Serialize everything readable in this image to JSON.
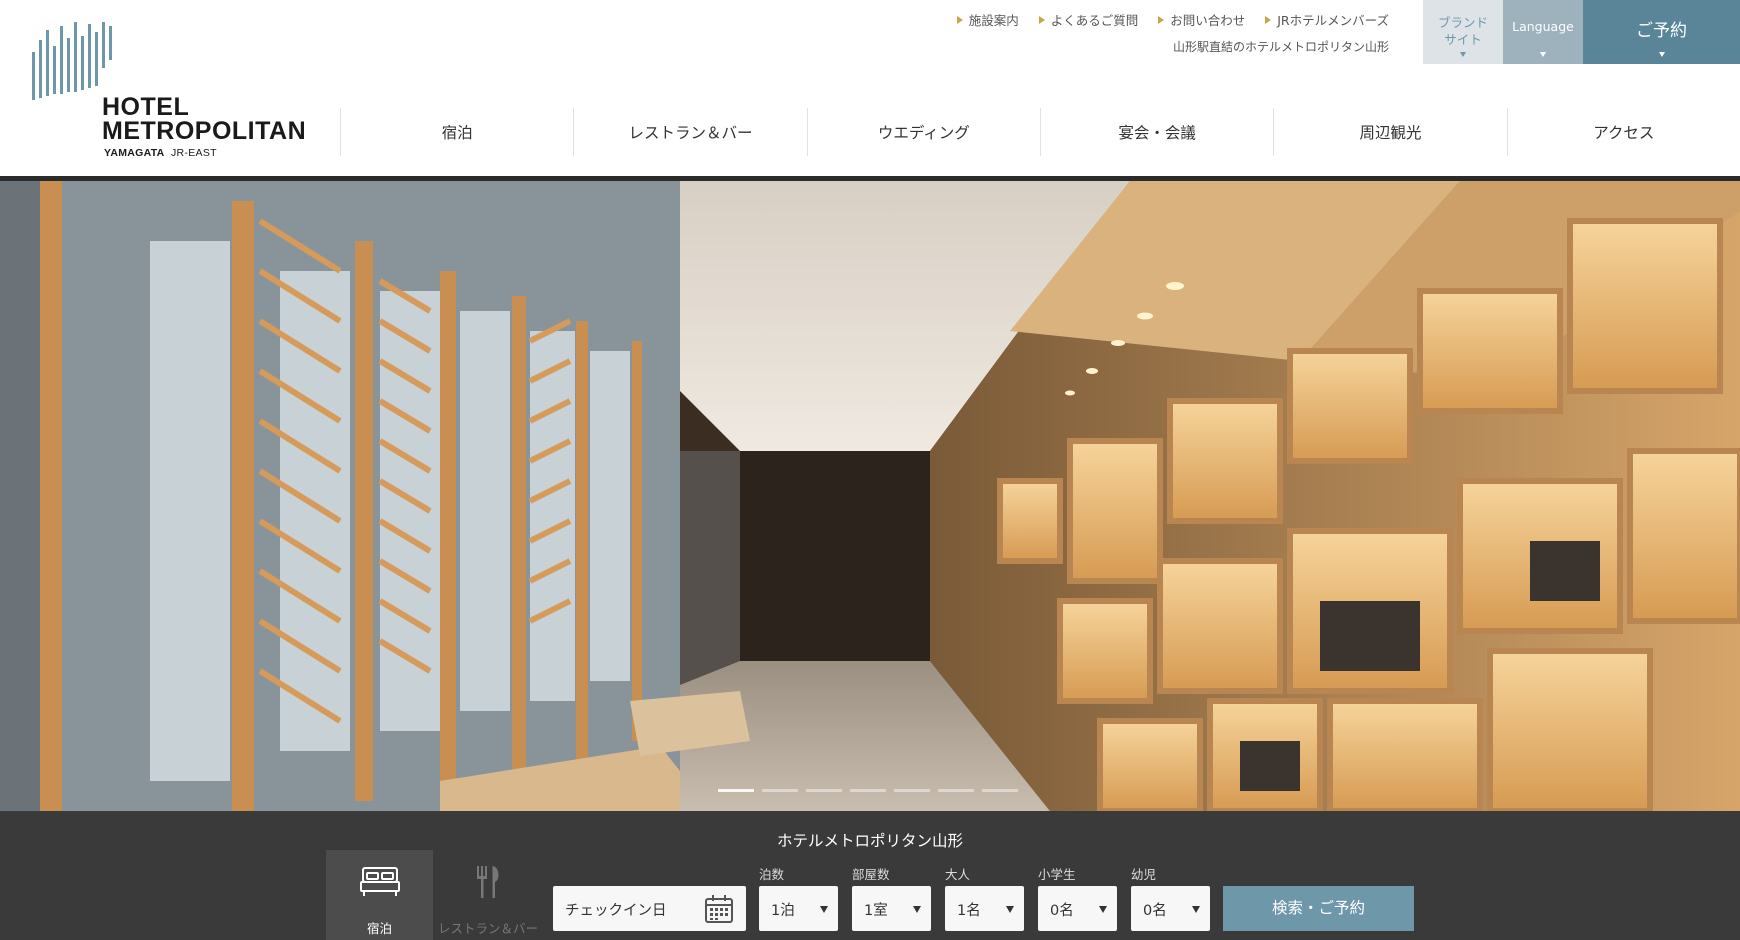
{
  "brand": {
    "name_line1": "HOTEL",
    "name_line2": "METROPOLITAN",
    "sub_city": "YAMAGATA",
    "sub_rail": "JR-EAST"
  },
  "utility_links": [
    {
      "label": "施設案内"
    },
    {
      "label": "よくあるご質問"
    },
    {
      "label": "お問い合わせ"
    },
    {
      "label": "JRホテルメンバーズ"
    }
  ],
  "tagline": "山形駅直結のホテルメトロポリタン山形",
  "header_buttons": {
    "brand_site": "ブランド\nサイト",
    "language": "Language",
    "reserve": "ご予約"
  },
  "nav": [
    {
      "label": "宿泊"
    },
    {
      "label": "レストラン＆バー"
    },
    {
      "label": "ウエディング"
    },
    {
      "label": "宴会・会議"
    },
    {
      "label": "周辺観光"
    },
    {
      "label": "アクセス"
    }
  ],
  "hero": {
    "slide_count": 7,
    "active_slide": 0
  },
  "booking": {
    "title": "ホテルメトロポリタン山形",
    "tabs": [
      {
        "label": "宿泊",
        "active": true,
        "icon": "bed-icon"
      },
      {
        "label": "レストラン＆バー",
        "active": false,
        "icon": "fork-knife-icon"
      }
    ],
    "checkin_label": "チェックイン日",
    "fields": [
      {
        "label": "泊数",
        "value": "1泊"
      },
      {
        "label": "部屋数",
        "value": "1室"
      },
      {
        "label": "大人",
        "value": "1名"
      },
      {
        "label": "小学生",
        "value": "0名"
      },
      {
        "label": "幼児",
        "value": "0名"
      }
    ],
    "search_label": "検索・ご予約"
  },
  "colors": {
    "accent": "#6f97aa",
    "reserve": "#5a8498",
    "gold": "#c9a544"
  }
}
